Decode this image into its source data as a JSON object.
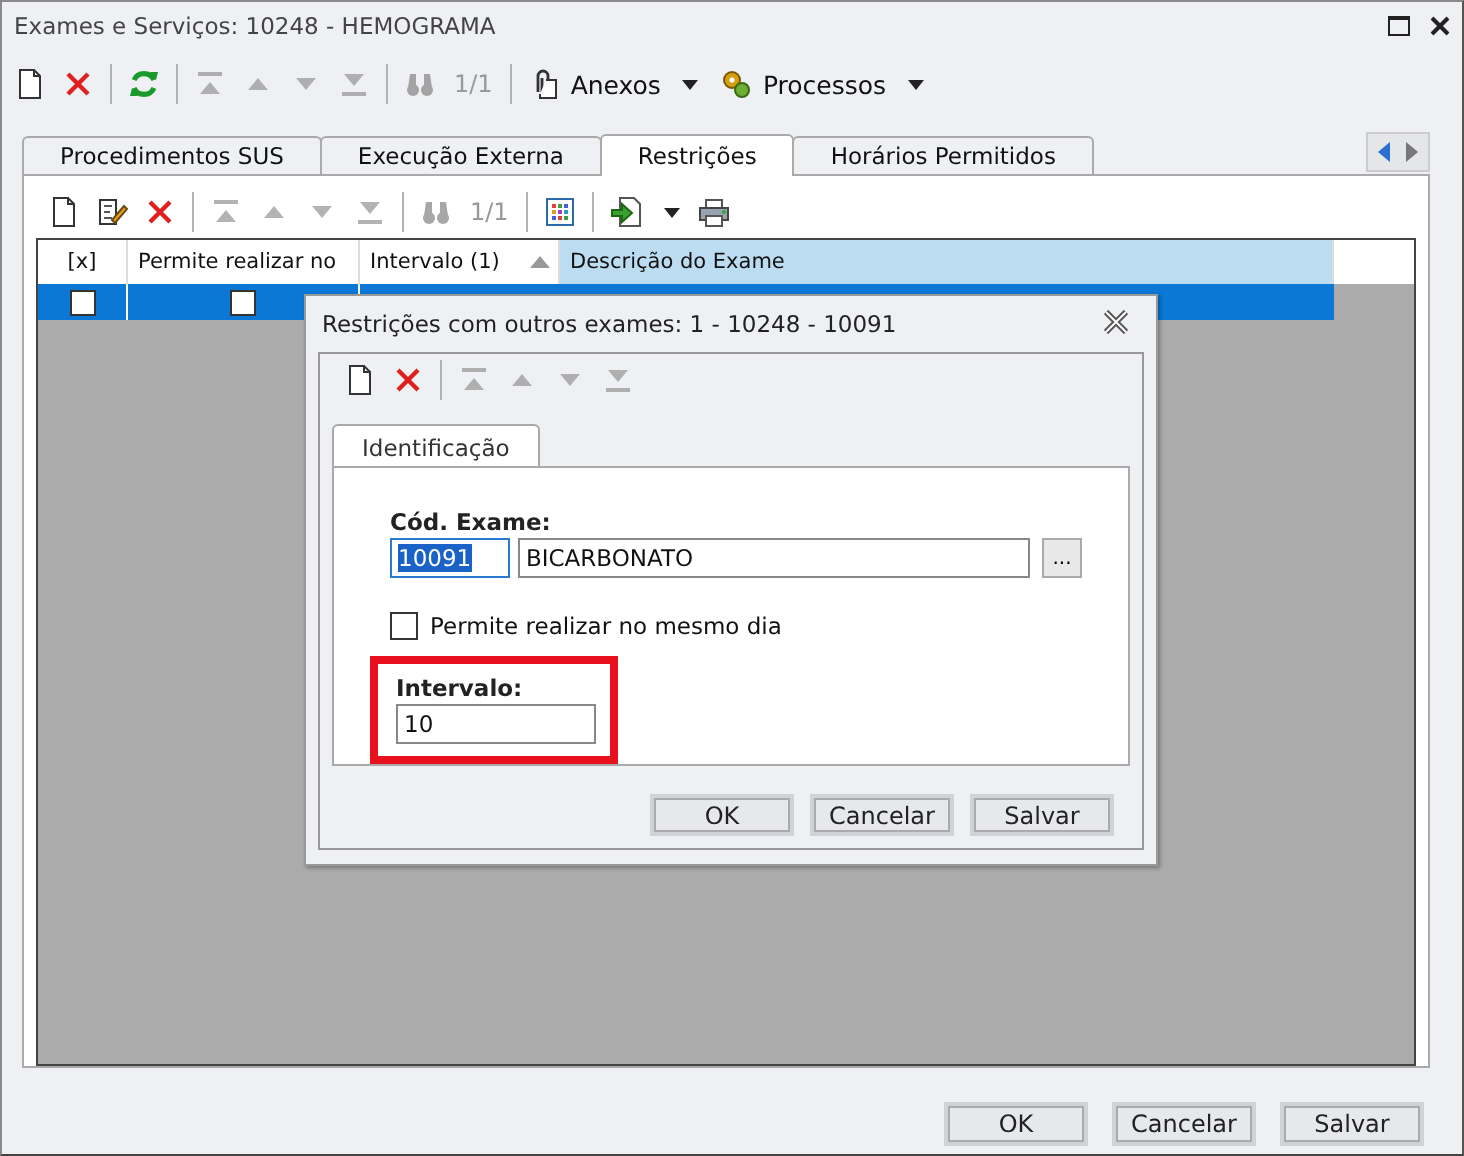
{
  "window": {
    "title": "Exames e Serviços: 10248 - HEMOGRAMA"
  },
  "toolbar": [
    {
      "kind": "new"
    },
    {
      "kind": "delete"
    },
    {
      "kind": "sep"
    },
    {
      "kind": "refresh"
    },
    {
      "kind": "sep"
    },
    {
      "kind": "first",
      "disabled": true
    },
    {
      "kind": "prev",
      "disabled": true
    },
    {
      "kind": "next",
      "disabled": true
    },
    {
      "kind": "last",
      "disabled": true
    },
    {
      "kind": "sep"
    },
    {
      "kind": "find",
      "disabled": true
    },
    {
      "kind": "counter",
      "label": "1/1"
    },
    {
      "kind": "sep"
    },
    {
      "kind": "attach",
      "label": "Anexos"
    },
    {
      "kind": "process",
      "label": "Processos"
    }
  ],
  "tabs": [
    {
      "label": "Procedimentos SUS",
      "selected": false
    },
    {
      "label": "Execução Externa",
      "selected": false
    },
    {
      "label": "Restrições",
      "selected": true
    },
    {
      "label": "Horários Permitidos",
      "selected": false
    }
  ],
  "grid_toolbar": [
    {
      "kind": "new"
    },
    {
      "kind": "edit"
    },
    {
      "kind": "delete"
    },
    {
      "kind": "sep"
    },
    {
      "kind": "first",
      "disabled": true
    },
    {
      "kind": "prev",
      "disabled": true
    },
    {
      "kind": "next",
      "disabled": true
    },
    {
      "kind": "last",
      "disabled": true
    },
    {
      "kind": "sep"
    },
    {
      "kind": "find",
      "disabled": true
    },
    {
      "kind": "counter",
      "label": "1/1"
    },
    {
      "kind": "sep"
    },
    {
      "kind": "grid"
    },
    {
      "kind": "sep"
    },
    {
      "kind": "export"
    },
    {
      "kind": "print"
    }
  ],
  "table": {
    "columns": [
      {
        "label": "[x]",
        "sorted": false
      },
      {
        "label": "Permite realizar no",
        "sorted": false
      },
      {
        "label": "Intervalo (1)",
        "sorted": true
      },
      {
        "label": "Descrição do Exame",
        "sorted": false
      }
    ],
    "rows": [
      {
        "selected": true,
        "checked": false,
        "same_day": false
      }
    ]
  },
  "dialog": {
    "title": "Restrições com outros exames: 1 - 10248 - 10091",
    "toolbar": [
      {
        "kind": "new"
      },
      {
        "kind": "delete"
      },
      {
        "kind": "sep"
      },
      {
        "kind": "first",
        "disabled": true
      },
      {
        "kind": "prev",
        "disabled": true
      },
      {
        "kind": "next",
        "disabled": true
      },
      {
        "kind": "last",
        "disabled": true
      }
    ],
    "tabs": [
      {
        "label": "Identificação",
        "selected": true
      }
    ],
    "code_label": "Cód. Exame:",
    "code_value": "10091",
    "description_value": "BICARBONATO",
    "lookup_button": "...",
    "same_day": {
      "label": "Permite realizar no mesmo dia",
      "checked": false
    },
    "interval": {
      "label": "Intervalo:",
      "value": "10",
      "highlighted": true
    },
    "buttons": [
      "OK",
      "Cancelar",
      "Salvar"
    ]
  },
  "buttons": [
    "OK",
    "Cancelar",
    "Salvar"
  ]
}
